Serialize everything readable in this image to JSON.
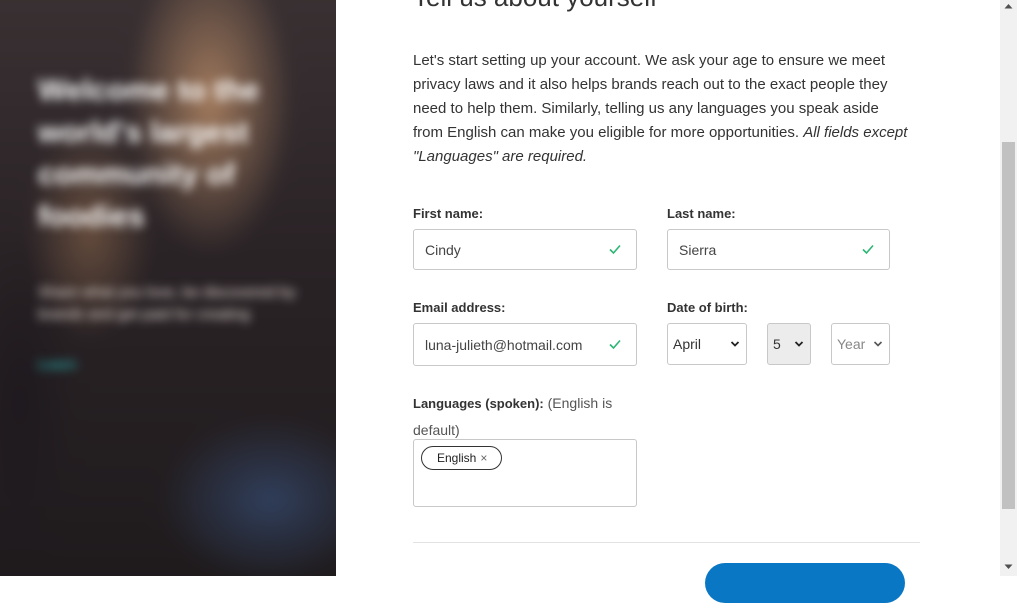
{
  "hero": {
    "title": "Welcome to the world's largest community of foodies",
    "subtitle": "Share what you love, be discovered by brands and get paid for creating",
    "link": "Learn"
  },
  "form": {
    "heading": "Tell us about yourself",
    "intro": "Let's start setting up your account. We ask your age to ensure we meet privacy laws and it also helps brands reach out to the exact people they need to help them. Similarly, telling us any languages you speak aside from English can make you eligible for more opportunities. ",
    "intro_em": "All fields except \"Languages\" are required.",
    "first_name": {
      "label": "First name:",
      "value": "Cindy"
    },
    "last_name": {
      "label": "Last name:",
      "value": "Sierra"
    },
    "email": {
      "label": "Email address:",
      "value": "luna-julieth@hotmail.com"
    },
    "dob": {
      "label": "Date of birth:",
      "month": "April",
      "day": "5",
      "year_placeholder": "Year"
    },
    "languages": {
      "label": "Languages (spoken):",
      "hint": " (English is default)",
      "chips": [
        {
          "label": "English",
          "remove": "×"
        }
      ]
    }
  },
  "colors": {
    "accent": "#0a77c4",
    "valid": "#2bb673"
  }
}
